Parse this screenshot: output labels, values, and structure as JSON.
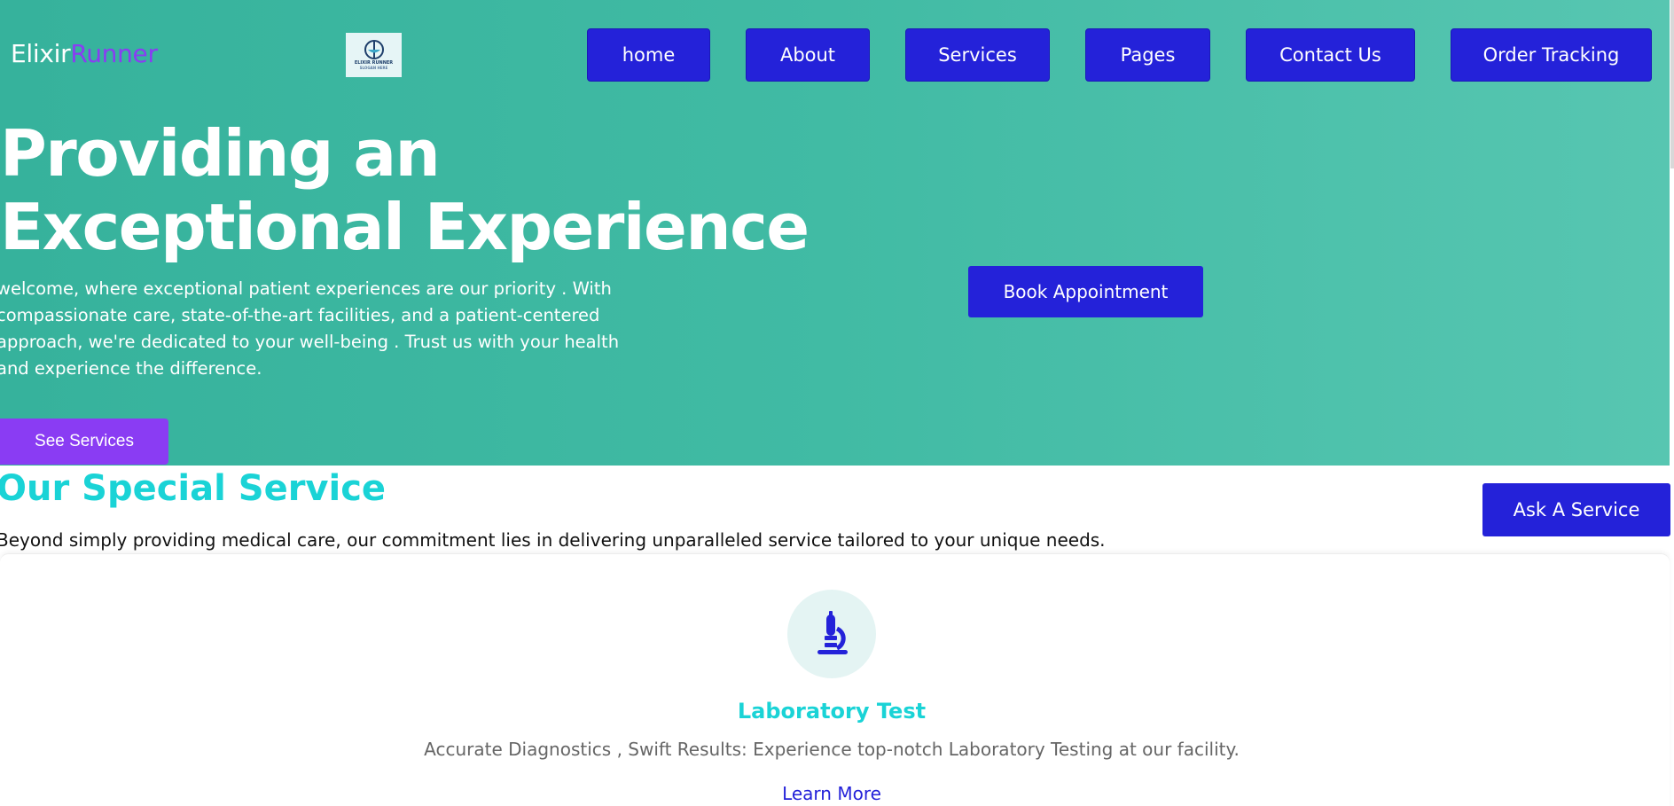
{
  "header": {
    "brand_part1": "Elixir",
    "brand_part2": "Runner",
    "logo_text_1": "ELIXIR RUNNER",
    "logo_text_2": "SLOGAN HERE",
    "nav": [
      "home",
      "About",
      "Services",
      "Pages",
      "Contact Us",
      "Order Tracking"
    ]
  },
  "hero": {
    "title": "Providing an Exceptional Experience",
    "subtitle": "welcome, where exceptional patient experiences are our priority . With compassionate care, state-of-the-art facilities, and a patient-centered approach, we're dedicated to your well-being . Trust us with your health and experience the difference.",
    "book_button": "Book Appointment",
    "see_services_button": "See Services"
  },
  "special": {
    "title": "Our Special Service",
    "subtitle": "Beyond simply providing medical care, our commitment lies in delivering unparalleled service tailored to your unique needs.",
    "ask_button": "Ask A Service"
  },
  "service_card": {
    "icon": "microscope-icon",
    "title": "Laboratory Test",
    "description": "Accurate Diagnostics , Swift Results: Experience top-notch Laboratory Testing at our facility.",
    "link": "Learn More"
  },
  "colors": {
    "hero_start": "#36b29c",
    "hero_end": "#57c6b1",
    "primary_button": "#2422d9",
    "accent_purple": "#8a3cf3",
    "heading_cyan": "#1ad3d6"
  }
}
